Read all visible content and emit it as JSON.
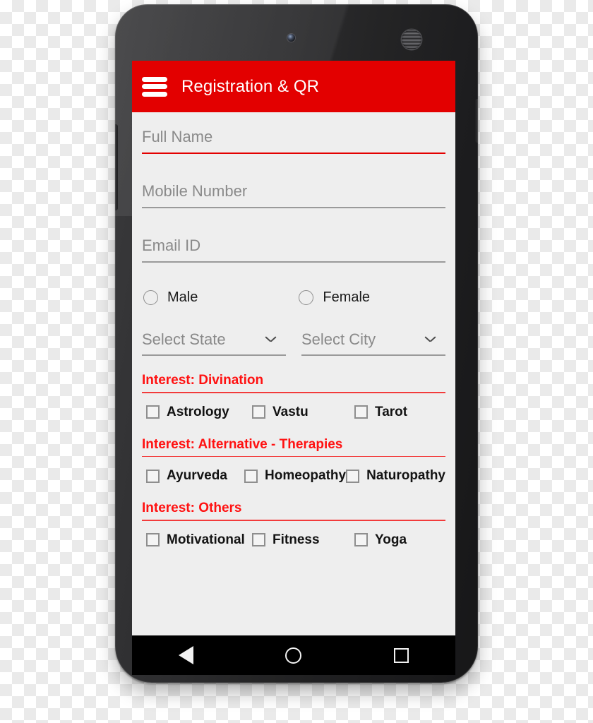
{
  "app": {
    "bar": {
      "menu_icon": "hamburger-menu-icon",
      "title": "Registration & QR",
      "background_color": "#e30000",
      "title_color": "#ffffff"
    },
    "screen_background": "#eeeeee"
  },
  "form": {
    "fields": [
      {
        "name": "full-name",
        "placeholder": "Full Name",
        "value": "",
        "focused": true
      },
      {
        "name": "mobile-number",
        "placeholder": "Mobile Number",
        "value": "",
        "focused": false
      },
      {
        "name": "email-id",
        "placeholder": "Email ID",
        "value": "",
        "focused": false
      }
    ],
    "gender": {
      "options": [
        {
          "label": "Male",
          "selected": false
        },
        {
          "label": "Female",
          "selected": false
        }
      ]
    },
    "selects": [
      {
        "name": "select-state",
        "value": "Select State",
        "icon": "chevron-down-icon"
      },
      {
        "name": "select-city",
        "value": "Select City",
        "icon": "chevron-down-icon"
      }
    ]
  },
  "interests": {
    "heading_color": "#ff1111",
    "sections": [
      {
        "title": "Interest: Divination",
        "options": [
          {
            "label": "Astrology",
            "checked": false
          },
          {
            "label": "Vastu",
            "checked": false
          },
          {
            "label": "Tarot",
            "checked": false
          }
        ]
      },
      {
        "title": "Interest: Alternative - Therapies",
        "options": [
          {
            "label": "Ayurveda",
            "checked": false
          },
          {
            "label": "Homeopathy",
            "checked": false
          },
          {
            "label": "Naturopathy",
            "checked": false
          }
        ]
      },
      {
        "title": "Interest: Others",
        "options": [
          {
            "label": "Motivational",
            "checked": false
          },
          {
            "label": "Fitness",
            "checked": false
          },
          {
            "label": "Yoga",
            "checked": false
          }
        ]
      }
    ]
  },
  "navbar": {
    "buttons": [
      {
        "name": "back-icon",
        "glyph": "triangle-left"
      },
      {
        "name": "home-icon",
        "glyph": "circle"
      },
      {
        "name": "recents-icon",
        "glyph": "square"
      }
    ]
  },
  "device": {
    "hardware": {
      "front_camera": "front-camera",
      "earpiece": "earpiece-speaker",
      "sensors": "proximity-sensors",
      "volume_button": "volume-rocker",
      "power_button": "power-button"
    }
  }
}
